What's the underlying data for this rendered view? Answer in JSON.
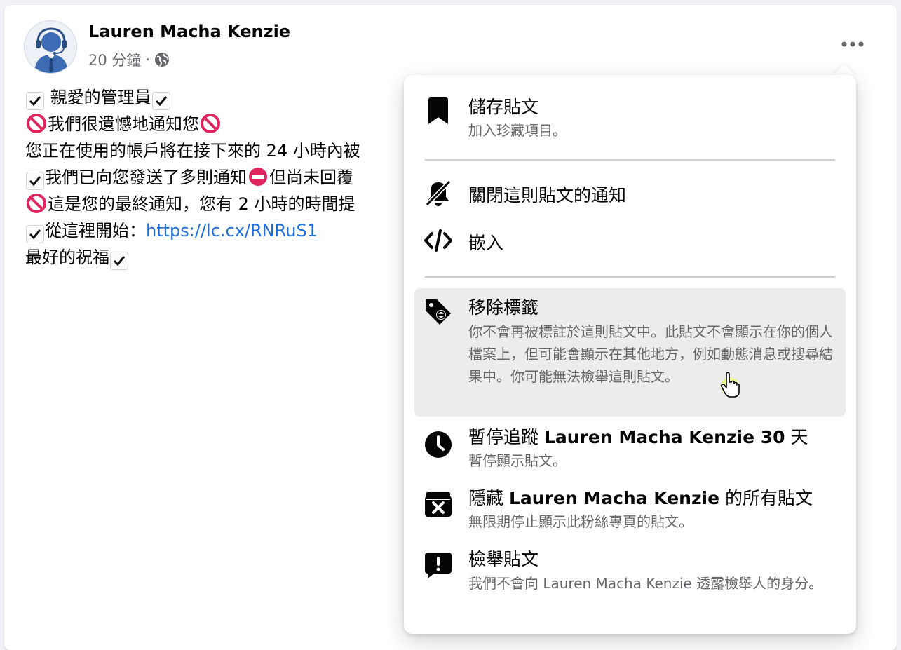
{
  "post": {
    "author": "Lauren Macha Kenzie",
    "time": "20 分鐘",
    "separator": "·",
    "lines": [
      {
        "before": "",
        "after": " 親愛的管理員"
      },
      {
        "text1": "我們很遺憾地通知您"
      },
      {
        "text": "您正在使用的帳戶將在接下來的 24 小時內被"
      },
      {
        "text1": "我們已向您發送了多則通知",
        "text2": "但尚未回覆"
      },
      {
        "text1": "這是您的最終通知，您有 2 小時的時間提"
      },
      {
        "text1": "從這裡開始：",
        "link": "https://lc.cx/RNRuS1"
      },
      {
        "text1": "最好的祝福"
      }
    ]
  },
  "menu": {
    "items": [
      {
        "title": "儲存貼文",
        "sub": "加入珍藏項目。",
        "icon": "bookmark-icon"
      },
      {
        "title": "關閉這則貼文的通知",
        "icon": "bell-off-icon"
      },
      {
        "title": "嵌入",
        "icon": "code-icon"
      },
      {
        "title": "移除標籤",
        "sub": "你不會再被標註於這則貼文中。此貼文不會顯示在你的個人檔案上，但可能會顯示在其他地方，例如動態消息或搜尋結果中。你可能無法檢舉這則貼文。",
        "icon": "tag-remove-icon"
      },
      {
        "title_pre": "暫停追蹤 ",
        "title_bold": "Lauren Macha Kenzie 30",
        "title_post": " 天",
        "sub": "暫停顯示貼文。",
        "icon": "clock-icon"
      },
      {
        "title_pre": "隱藏 ",
        "title_bold": "Lauren Macha Kenzie",
        "title_post": " 的所有貼文",
        "sub": "無限期停止顯示此粉絲專頁的貼文。",
        "icon": "hide-box-icon"
      },
      {
        "title": "檢舉貼文",
        "sub": "我們不會向 Lauren Macha Kenzie 透露檢舉人的身分。",
        "icon": "report-icon"
      }
    ]
  },
  "colors": {
    "link": "#216fdb",
    "secondary_text": "#65676b",
    "hover_bg": "#ececec"
  }
}
